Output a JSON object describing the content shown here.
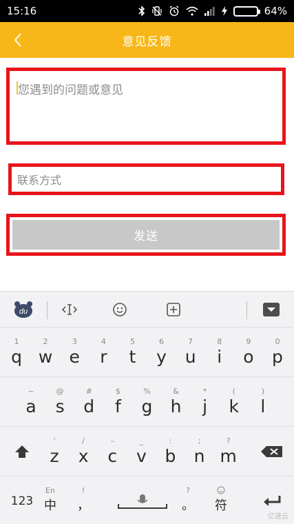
{
  "status_bar": {
    "time": "15:16",
    "battery_percent_text": "64%",
    "battery_level": 0.64,
    "icons": [
      "bluetooth-icon",
      "vibrate-off-icon",
      "alarm-icon",
      "wifi-icon",
      "signal-icon",
      "charging-icon",
      "battery-icon"
    ]
  },
  "app_bar": {
    "title": "意见反馈",
    "back_icon": "chevron-left-icon",
    "color": "#f7b718"
  },
  "form": {
    "feedback_placeholder": "您遇到的问题或意见",
    "contact_placeholder": "联系方式",
    "send_label": "发送",
    "highlight_color": "#e8141b",
    "send_color": "#c8c8c8"
  },
  "keyboard": {
    "toolbar": [
      "du-logo-icon",
      "cursor-move-icon",
      "emoji-icon",
      "add-box-icon",
      "hide-keyboard-icon"
    ],
    "row1": [
      {
        "sub": "1",
        "main": "q"
      },
      {
        "sub": "2",
        "main": "w"
      },
      {
        "sub": "3",
        "main": "e"
      },
      {
        "sub": "4",
        "main": "r"
      },
      {
        "sub": "5",
        "main": "t"
      },
      {
        "sub": "6",
        "main": "y"
      },
      {
        "sub": "7",
        "main": "u"
      },
      {
        "sub": "8",
        "main": "i"
      },
      {
        "sub": "9",
        "main": "o"
      },
      {
        "sub": "0",
        "main": "p"
      }
    ],
    "row2": [
      {
        "sub": "~",
        "main": "a"
      },
      {
        "sub": "@",
        "main": "s"
      },
      {
        "sub": "#",
        "main": "d"
      },
      {
        "sub": "$",
        "main": "f"
      },
      {
        "sub": "%",
        "main": "g"
      },
      {
        "sub": "&",
        "main": "h"
      },
      {
        "sub": "*",
        "main": "j"
      },
      {
        "sub": "(",
        "main": "k"
      },
      {
        "sub": ")",
        "main": "l"
      }
    ],
    "row3": [
      {
        "sub": "'",
        "main": "z"
      },
      {
        "sub": "/",
        "main": "x"
      },
      {
        "sub": "–",
        "main": "c"
      },
      {
        "sub": "_",
        "main": "v"
      },
      {
        "sub": ":",
        "main": "b"
      },
      {
        "sub": ";",
        "main": "n"
      },
      {
        "sub": "?",
        "main": "m"
      }
    ],
    "row4": {
      "numbers_label": "123",
      "lang_sub": "En",
      "lang_main": "中",
      "comma_sub": "!",
      "comma_main": "，",
      "period_sub": "?",
      "period_main": "。",
      "symbol_sub_icon": "smile-icon",
      "symbol_main": "符"
    },
    "watermark": "亿速云"
  }
}
